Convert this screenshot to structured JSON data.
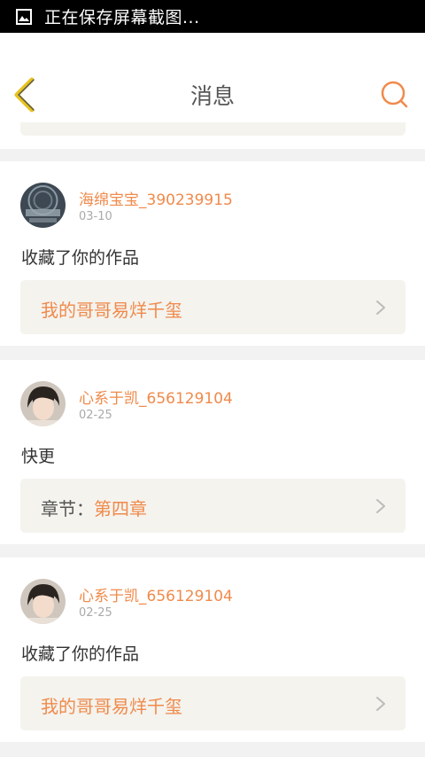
{
  "status_bar": {
    "text": "正在保存屏幕截图..."
  },
  "header": {
    "title": "消息"
  },
  "messages": [
    {
      "username": "海绵宝宝_390239915",
      "date": "03-10",
      "text": "收藏了你的作品",
      "ref_prefix": "",
      "ref_title": "我的哥哥易烊千玺"
    },
    {
      "username": "心系于凯_656129104",
      "date": "02-25",
      "text": "快更",
      "ref_prefix": "章节：",
      "ref_title": "第四章"
    },
    {
      "username": "心系于凯_656129104",
      "date": "02-25",
      "text": "收藏了你的作品",
      "ref_prefix": "",
      "ref_title": "我的哥哥易烊千玺"
    }
  ],
  "colors": {
    "accent": "#f08a4b",
    "back_arrow": "#e8c21a",
    "card_bg": "#f4f3ee"
  }
}
